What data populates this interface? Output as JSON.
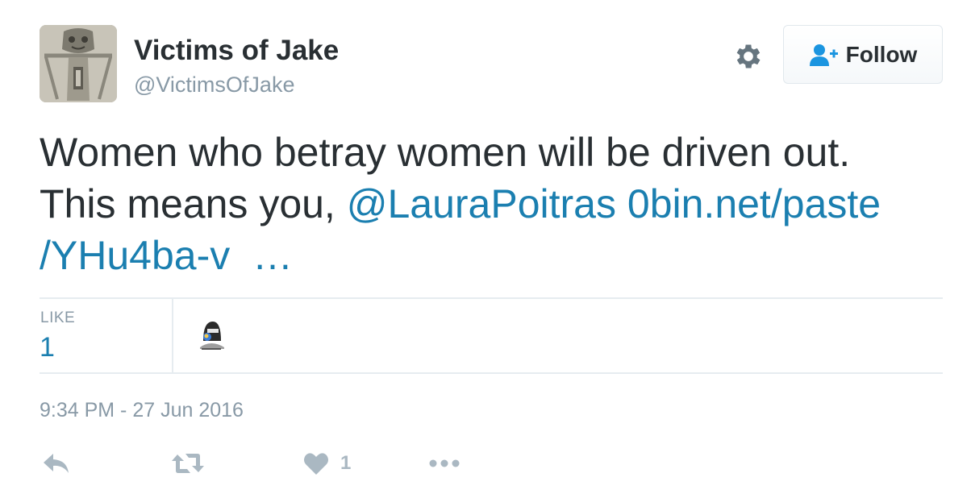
{
  "author": {
    "display_name": "Victims of Jake",
    "screen_name": "@VictimsOfJake"
  },
  "header": {
    "settings_icon": "gear-icon",
    "follow_label": "Follow",
    "follow_icon": "user-plus-icon"
  },
  "tweet": {
    "text_line1": "Women who betray women will be driven out.",
    "text_line2_prefix": "This means you, ",
    "mention": "@LauraPoitras",
    "link_part1": "0bin.net/paste",
    "link_part2": "/YHu4ba-v",
    "ellipsis": "…"
  },
  "stats": {
    "likes_label": "LIKE",
    "likes_count": "1"
  },
  "timestamp": "9:34 PM - 27 Jun 2016",
  "actions": {
    "reply_icon": "reply-icon",
    "retweet_icon": "retweet-icon",
    "like_icon": "heart-icon",
    "like_count": "1",
    "more_icon": "more-dots-icon"
  },
  "colors": {
    "link": "#1b7fb0",
    "muted": "#8899a6",
    "icon": "#aab8c2",
    "text": "#292f33"
  }
}
